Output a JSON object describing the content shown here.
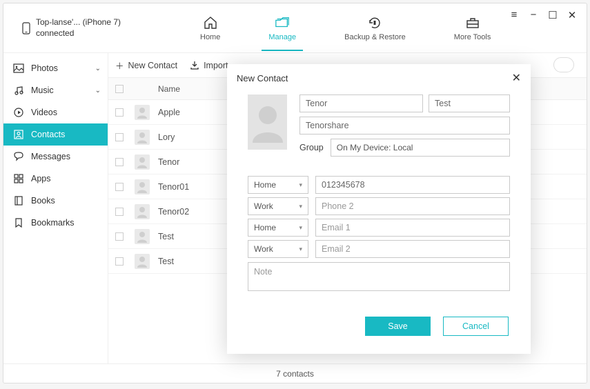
{
  "device": {
    "name": "Top-lanse'... (iPhone 7)",
    "status": "connected"
  },
  "main_tabs": {
    "home": "Home",
    "manage": "Manage",
    "backup_restore": "Backup & Restore",
    "more_tools": "More Tools",
    "active": "manage"
  },
  "sidebar": {
    "items": [
      {
        "label": "Photos",
        "icon": "image-icon",
        "expandable": true
      },
      {
        "label": "Music",
        "icon": "music-icon",
        "expandable": true
      },
      {
        "label": "Videos",
        "icon": "play-icon"
      },
      {
        "label": "Contacts",
        "icon": "contact-icon",
        "active": true
      },
      {
        "label": "Messages",
        "icon": "message-icon"
      },
      {
        "label": "Apps",
        "icon": "apps-icon"
      },
      {
        "label": "Books",
        "icon": "book-icon"
      },
      {
        "label": "Bookmarks",
        "icon": "bookmark-icon"
      }
    ]
  },
  "toolbar": {
    "new_contact": "New Contact",
    "import": "Import"
  },
  "list": {
    "header_name": "Name",
    "rows": [
      {
        "name": "Apple"
      },
      {
        "name": "Lory"
      },
      {
        "name": "Tenor"
      },
      {
        "name": "Tenor01"
      },
      {
        "name": "Tenor02"
      },
      {
        "name": "Test"
      },
      {
        "name": "Test"
      }
    ]
  },
  "footer": {
    "count": "7 contacts"
  },
  "dialog": {
    "title": "New Contact",
    "first_name": "Tenor",
    "last_name": "Test",
    "company": "Tenorshare",
    "group_label": "Group",
    "group_value": "On My Device: Local",
    "fields": [
      {
        "type": "Home",
        "value": "012345678"
      },
      {
        "type": "Work",
        "placeholder": "Phone 2"
      },
      {
        "type": "Home",
        "placeholder": "Email 1"
      },
      {
        "type": "Work",
        "placeholder": "Email 2"
      }
    ],
    "note_placeholder": "Note",
    "save": "Save",
    "cancel": "Cancel"
  }
}
